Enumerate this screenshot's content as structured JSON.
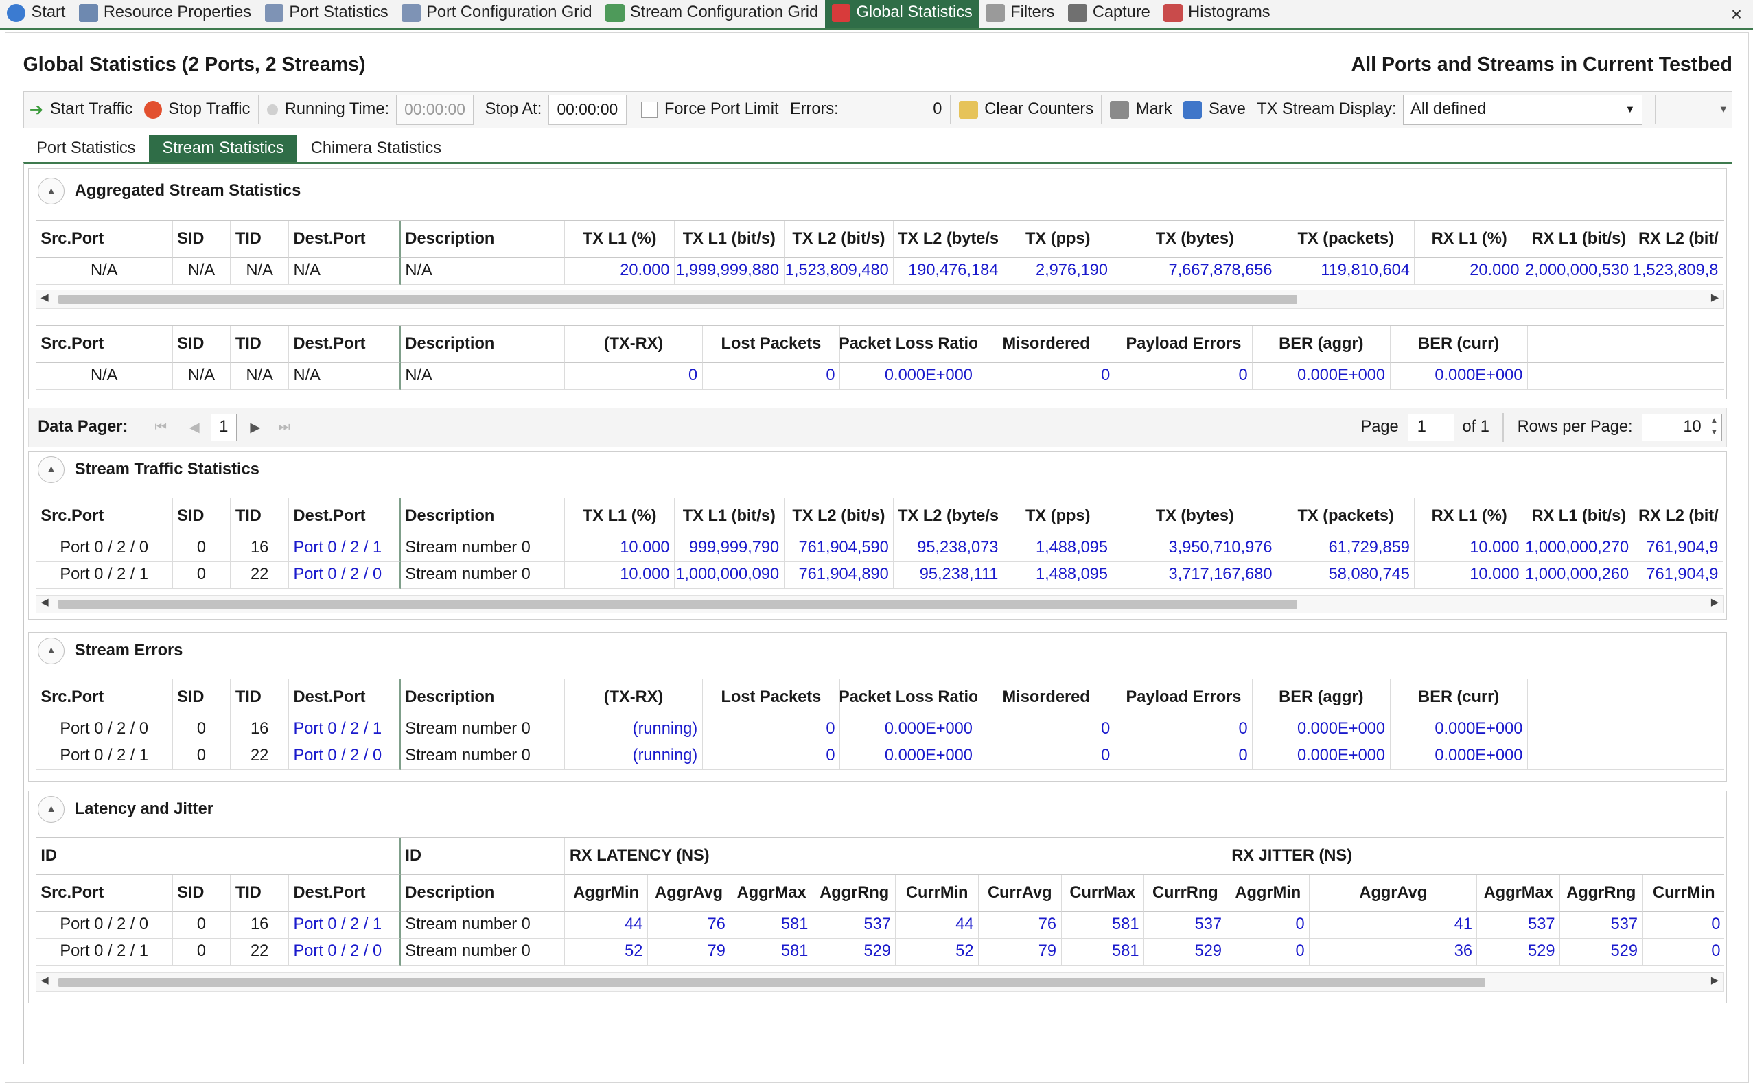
{
  "tabs": [
    {
      "label": "Start",
      "icon": "info-icon",
      "color": "#3b7bd1"
    },
    {
      "label": "Resource Properties",
      "icon": "properties-icon",
      "color": "#6e89b0"
    },
    {
      "label": "Port Statistics",
      "icon": "statistics-icon",
      "color": "#7e93b5"
    },
    {
      "label": "Port Configuration Grid",
      "icon": "grid-icon",
      "color": "#7e93b5"
    },
    {
      "label": "Stream Configuration Grid",
      "icon": "stream-grid-icon",
      "color": "#4e9a5a"
    },
    {
      "label": "Global Statistics",
      "icon": "chart-icon",
      "color": "#d83b3b"
    },
    {
      "label": "Filters",
      "icon": "filter-icon",
      "color": "#9a9a9a"
    },
    {
      "label": "Capture",
      "icon": "camera-icon",
      "color": "#707070"
    },
    {
      "label": "Histograms",
      "icon": "histogram-icon",
      "color": "#c94b4b"
    }
  ],
  "close_glyph": "×",
  "title": "Global Statistics (2 Ports, 2 Streams)",
  "subtitle": "All Ports and Streams in Current Testbed",
  "toolbar": {
    "start": "Start Traffic",
    "stop": "Stop Traffic",
    "running_label": "Running Time:",
    "running_value": "00:00:00",
    "stop_at_label": "Stop At:",
    "stop_at_value": "00:00:00",
    "force_label": "Force Port Limit",
    "errors_label": "Errors:",
    "errors_value": "0",
    "clear": "Clear Counters",
    "mark": "Mark",
    "save": "Save",
    "tx_display_label": "TX Stream Display:",
    "tx_display_value": "All defined"
  },
  "subtabs": [
    "Port Statistics",
    "Stream Statistics",
    "Chimera Statistics"
  ],
  "agg": {
    "title": "Aggregated Stream Statistics",
    "h1": [
      "Src.Port",
      "SID",
      "TID",
      "Dest.Port",
      "Description",
      "TX L1 (%)",
      "TX L1 (bit/s)",
      "TX L2 (bit/s)",
      "TX L2 (byte/s",
      "TX (pps)",
      "TX (bytes)",
      "TX (packets)",
      "RX L1 (%)",
      "RX L1 (bit/s)",
      "RX L2 (bit/"
    ],
    "r1": [
      "N/A",
      "N/A",
      "N/A",
      "N/A",
      "N/A",
      "20.000",
      "1,999,999,880",
      "1,523,809,480",
      "190,476,184",
      "2,976,190",
      "7,667,878,656",
      "119,810,604",
      "20.000",
      "2,000,000,530",
      "1,523,809,8"
    ],
    "h2": [
      "Src.Port",
      "SID",
      "TID",
      "Dest.Port",
      "Description",
      "(TX-RX)",
      "Lost Packets",
      "Packet Loss Ratio",
      "Misordered",
      "Payload Errors",
      "BER (aggr)",
      "BER (curr)",
      ""
    ],
    "r2": [
      "N/A",
      "N/A",
      "N/A",
      "N/A",
      "N/A",
      "0",
      "0",
      "0.000E+000",
      "0",
      "0",
      "0.000E+000",
      "0.000E+000",
      ""
    ]
  },
  "pager": {
    "label": "Data Pager:",
    "page_btn": "1",
    "page_label": "Page",
    "page_value": "1",
    "of_label": "of 1",
    "rows_label": "Rows per Page:",
    "rows_value": "10"
  },
  "traffic": {
    "title": "Stream Traffic Statistics",
    "h": [
      "Src.Port",
      "SID",
      "TID",
      "Dest.Port",
      "Description",
      "TX L1 (%)",
      "TX L1 (bit/s)",
      "TX L2 (bit/s)",
      "TX L2 (byte/s",
      "TX (pps)",
      "TX (bytes)",
      "TX (packets)",
      "RX L1 (%)",
      "RX L1 (bit/s)",
      "RX L2 (bit/"
    ],
    "rows": [
      [
        "Port 0 / 2 / 0",
        "0",
        "16",
        "Port 0 / 2 / 1",
        "Stream number 0",
        "10.000",
        "999,999,790",
        "761,904,590",
        "95,238,073",
        "1,488,095",
        "3,950,710,976",
        "61,729,859",
        "10.000",
        "1,000,000,270",
        "761,904,9"
      ],
      [
        "Port 0 / 2 / 1",
        "0",
        "22",
        "Port 0 / 2 / 0",
        "Stream number 0",
        "10.000",
        "1,000,000,090",
        "761,904,890",
        "95,238,111",
        "1,488,095",
        "3,717,167,680",
        "58,080,745",
        "10.000",
        "1,000,000,260",
        "761,904,9"
      ]
    ]
  },
  "errors": {
    "title": "Stream Errors",
    "h": [
      "Src.Port",
      "SID",
      "TID",
      "Dest.Port",
      "Description",
      "(TX-RX)",
      "Lost Packets",
      "Packet Loss Ratio",
      "Misordered",
      "Payload Errors",
      "BER (aggr)",
      "BER (curr)",
      ""
    ],
    "rows": [
      [
        "Port 0 / 2 / 0",
        "0",
        "16",
        "Port 0 / 2 / 1",
        "Stream number 0",
        "(running)",
        "0",
        "0.000E+000",
        "0",
        "0",
        "0.000E+000",
        "0.000E+000",
        ""
      ],
      [
        "Port 0 / 2 / 1",
        "0",
        "22",
        "Port 0 / 2 / 0",
        "Stream number 0",
        "(running)",
        "0",
        "0.000E+000",
        "0",
        "0",
        "0.000E+000",
        "0.000E+000",
        ""
      ]
    ]
  },
  "latency": {
    "title": "Latency and Jitter",
    "g1": [
      "ID",
      "ID",
      "RX LATENCY (NS)",
      "RX JITTER (NS)"
    ],
    "h": [
      "Src.Port",
      "SID",
      "TID",
      "Dest.Port",
      "Description",
      "AggrMin",
      "AggrAvg",
      "AggrMax",
      "AggrRng",
      "CurrMin",
      "CurrAvg",
      "CurrMax",
      "CurrRng",
      "AggrMin",
      "AggrAvg",
      "AggrMax",
      "AggrRng",
      "CurrMin"
    ],
    "rows": [
      [
        "Port 0 / 2 / 0",
        "0",
        "16",
        "Port 0 / 2 / 1",
        "Stream number 0",
        "44",
        "76",
        "581",
        "537",
        "44",
        "76",
        "581",
        "537",
        "0",
        "41",
        "537",
        "537",
        "0"
      ],
      [
        "Port 0 / 2 / 1",
        "0",
        "22",
        "Port 0 / 2 / 0",
        "Stream number 0",
        "52",
        "79",
        "581",
        "529",
        "52",
        "79",
        "581",
        "529",
        "0",
        "36",
        "529",
        "529",
        "0"
      ]
    ]
  }
}
